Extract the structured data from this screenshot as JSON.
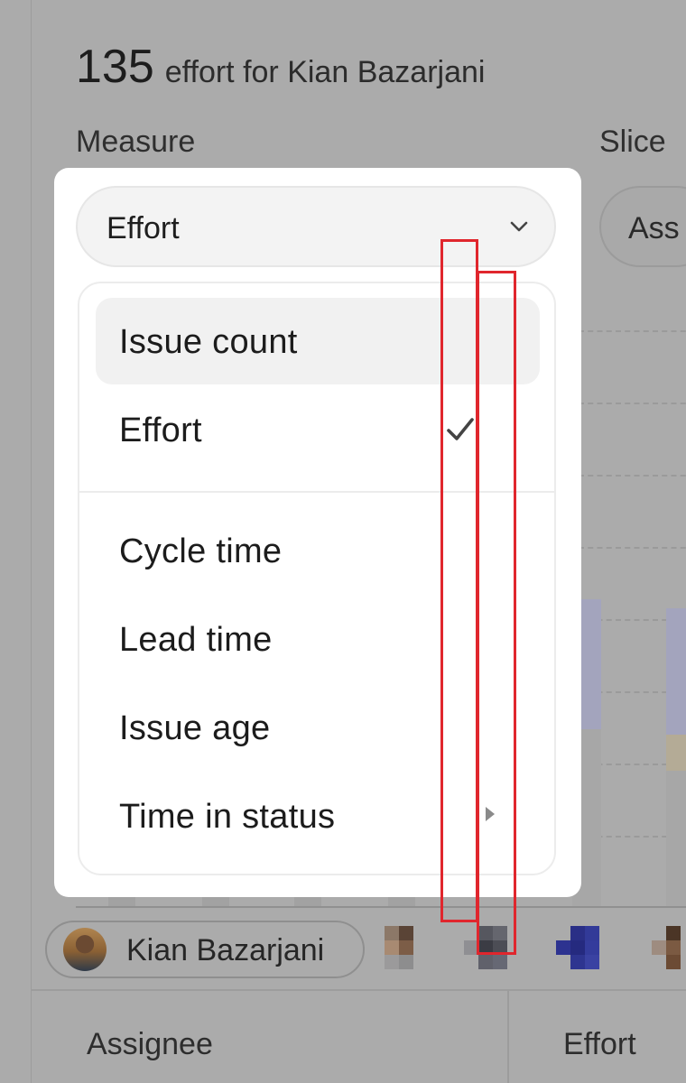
{
  "header": {
    "count": "135",
    "subtitle": "effort for Kian Bazarjani"
  },
  "controls": {
    "measure_label": "Measure",
    "measure_value": "Effort",
    "slice_label": "Slice",
    "slice_value": "Ass"
  },
  "measure_menu": {
    "group1": [
      {
        "label": "Issue count",
        "highlighted": true,
        "selected": false
      },
      {
        "label": "Effort",
        "highlighted": false,
        "selected": true
      }
    ],
    "group2": [
      {
        "label": "Cycle time",
        "submenu": false
      },
      {
        "label": "Lead time",
        "submenu": false
      },
      {
        "label": "Issue age",
        "submenu": false
      },
      {
        "label": "Time in status",
        "submenu": true
      }
    ]
  },
  "chart": {
    "assignee_chip": "Kian Bazarjani"
  },
  "table": {
    "headers": [
      "Assignee",
      "Effort"
    ]
  },
  "icons": {
    "measure_chevron": "chevron-down-icon",
    "selected_mark": "checkmark-icon",
    "submenu": "chevron-right-icon",
    "user": "avatar"
  },
  "colors": {
    "overlay_background": "#ababab",
    "annotation_red": "#e0262d",
    "menu_highlight": "#f1f1f1"
  }
}
